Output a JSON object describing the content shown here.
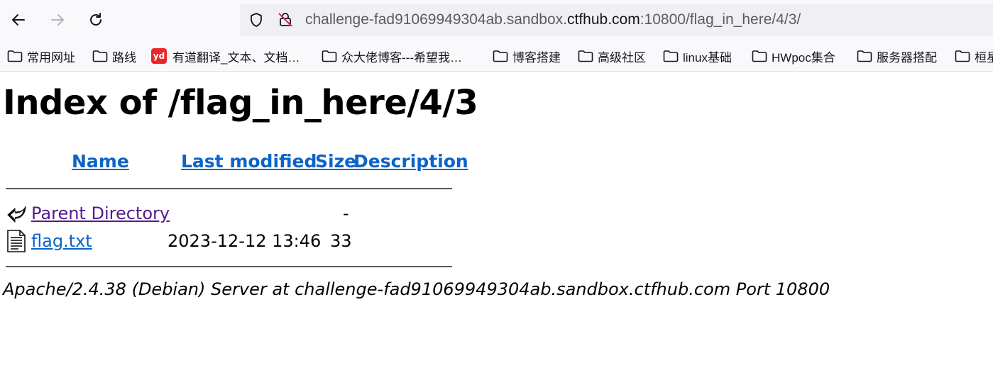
{
  "browser": {
    "url_prefix": "challenge-fad91069949304ab.sandbox.",
    "url_domain": "ctfhub.com",
    "url_suffix": ":10800/flag_in_here/4/3/"
  },
  "bookmarks": [
    {
      "label": "常用网址",
      "icon": "folder-icon"
    },
    {
      "label": "路线",
      "icon": "folder-icon"
    },
    {
      "label": "有道翻译_文本、文档…",
      "icon": "youdao-icon"
    },
    {
      "label": "众大佬博客---希望我…",
      "icon": "folder-icon"
    },
    {
      "label": "博客搭建",
      "icon": "folder-icon"
    },
    {
      "label": "高级社区",
      "icon": "folder-icon"
    },
    {
      "label": "linux基础",
      "icon": "folder-icon"
    },
    {
      "label": "HWpoc集合",
      "icon": "folder-icon"
    },
    {
      "label": "服务器搭配",
      "icon": "folder-icon"
    },
    {
      "label": "桓星",
      "icon": "folder-icon"
    }
  ],
  "youdao_logo_text": "yd",
  "page": {
    "title": "Index of /flag_in_here/4/3",
    "columns": {
      "name": "Name",
      "last_modified": "Last modified",
      "size": "Size",
      "description": "Description"
    },
    "rows": [
      {
        "name": "Parent Directory",
        "last_modified": "",
        "size": "-",
        "description": "",
        "icon": "back-arrow-icon"
      },
      {
        "name": "flag.txt",
        "last_modified": "2023-12-12 13:46",
        "size": "33",
        "description": "",
        "icon": "text-file-icon"
      }
    ],
    "address": "Apache/2.4.38 (Debian) Server at challenge-fad91069949304ab.sandbox.ctfhub.com Port 10800"
  },
  "colors": {
    "link": "#0b64c8",
    "visited_link": "#551a8b",
    "toolbar_bg": "#f9f9fb",
    "urlbar_bg": "#f0f0f4"
  }
}
